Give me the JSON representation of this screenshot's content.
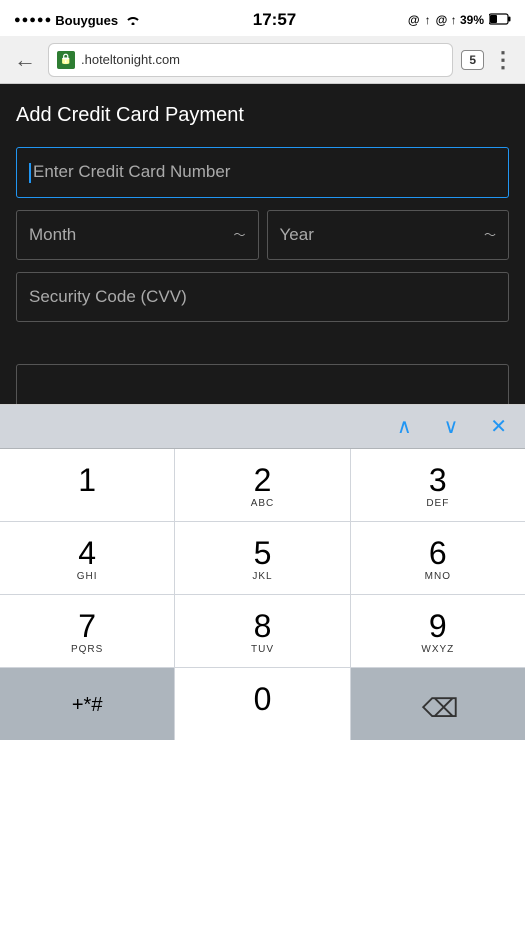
{
  "statusBar": {
    "carrier": "Bouygues",
    "time": "17:57",
    "rightIcons": "@ ↑ 39%",
    "signal_dots": "●●●●●"
  },
  "browser": {
    "backLabel": "←",
    "urlText": ".hoteltonight.com",
    "tabCount": "5",
    "moreLabel": "⋮"
  },
  "form": {
    "title": "Add Credit Card Payment",
    "cardNumberPlaceholder": "Enter Credit Card Number",
    "monthLabel": "Month",
    "yearLabel": "Year",
    "cvvPlaceholder": "Security Code (CVV)"
  },
  "keyboard": {
    "upArrow": "∧",
    "downArrow": "∨",
    "closeX": "✕",
    "keys": [
      {
        "number": "1",
        "letters": ""
      },
      {
        "number": "2",
        "letters": "ABC"
      },
      {
        "number": "3",
        "letters": "DEF"
      },
      {
        "number": "4",
        "letters": "GHI"
      },
      {
        "number": "5",
        "letters": "JKL"
      },
      {
        "number": "6",
        "letters": "MNO"
      },
      {
        "number": "7",
        "letters": "PQRS"
      },
      {
        "number": "8",
        "letters": "TUV"
      },
      {
        "number": "9",
        "letters": "WXYZ"
      },
      {
        "number": "+*#",
        "letters": ""
      },
      {
        "number": "0",
        "letters": ""
      },
      {
        "number": "⌫",
        "letters": ""
      }
    ]
  }
}
